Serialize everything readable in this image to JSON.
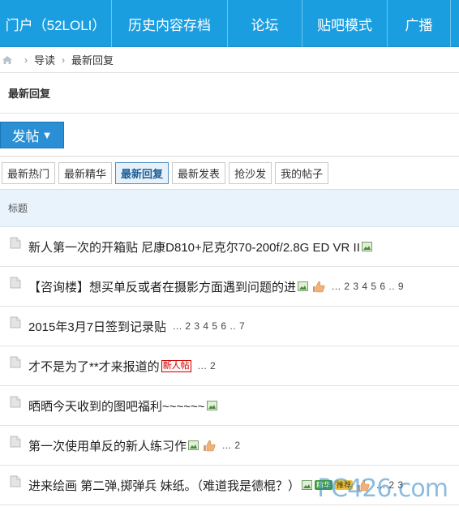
{
  "topnav": [
    {
      "label": "门户（52LOLI）"
    },
    {
      "label": "历史内容存档"
    },
    {
      "label": "论坛"
    },
    {
      "label": "贴吧模式"
    },
    {
      "label": "广播"
    }
  ],
  "breadcrumb": {
    "items": [
      "导读",
      "最新回复"
    ],
    "separator": "›"
  },
  "forum_title": "最新回复",
  "post_button": {
    "label": "发帖",
    "caret": "▼"
  },
  "filter_tabs": [
    "最新热门",
    "最新精华",
    "最新回复",
    "最新发表",
    "抢沙发",
    "我的帖子"
  ],
  "active_filter": "最新回复",
  "list_header": "标题",
  "threads": [
    {
      "title": "新人第一次的开箱贴 尼康D810+尼克尔70-200f/2.8G ED VR II",
      "has_image": true,
      "has_thumb": false,
      "pages": ""
    },
    {
      "title": "【咨询楼】想买单反或者在摄影方面遇到问题的进",
      "has_image": true,
      "has_thumb": true,
      "pages": "... 2 3 4 5 6 .. 9"
    },
    {
      "title": "2015年3月7日签到记录贴",
      "has_image": false,
      "has_thumb": false,
      "pages": "... 2 3 4 5 6 .. 7"
    },
    {
      "title": "才不是为了**才来报道的",
      "has_image": false,
      "has_thumb": false,
      "new_badge": "新人帖",
      "pages": "... 2"
    },
    {
      "title": "晒晒今天收到的图吧福利~~~~~~",
      "has_image": true,
      "has_thumb": false,
      "pages": ""
    },
    {
      "title": "第一次使用单反的新人练习作",
      "has_image": true,
      "has_thumb": true,
      "pages": "... 2"
    },
    {
      "title": "进来绘画 第二弹,掷弹兵 妹纸。（难道我是德棍？）",
      "has_image": true,
      "has_thumb": true,
      "extra_badges": [
        "精华",
        "推荐"
      ],
      "pages": "... 2 3"
    }
  ],
  "watermark": "PC426.com",
  "colors": {
    "nav_bg": "#1b9ee0",
    "post_button": "#2a8fd4",
    "list_header_bg": "#e9f3fb"
  }
}
